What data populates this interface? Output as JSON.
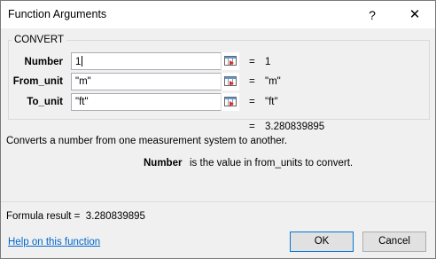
{
  "window": {
    "title": "Function Arguments",
    "help_glyph": "?",
    "close_glyph": "✕"
  },
  "function_group": {
    "name": "CONVERT",
    "args": [
      {
        "label": "Number",
        "value": "1",
        "result": "1"
      },
      {
        "label": "From_unit",
        "value": "\"m\"",
        "result": "\"m\""
      },
      {
        "label": "To_unit",
        "value": "\"ft\"",
        "result": "\"ft\""
      }
    ],
    "equals": "=",
    "function_result": "3.280839895"
  },
  "description": "Converts a number from one measurement system to another.",
  "argument_help": {
    "name": "Number",
    "text": "is the value in from_units to convert."
  },
  "formula_result": {
    "label": "Formula result =",
    "value": "3.280839895"
  },
  "footer": {
    "help_link": "Help on this function",
    "ok_label": "OK",
    "cancel_label": "Cancel"
  }
}
